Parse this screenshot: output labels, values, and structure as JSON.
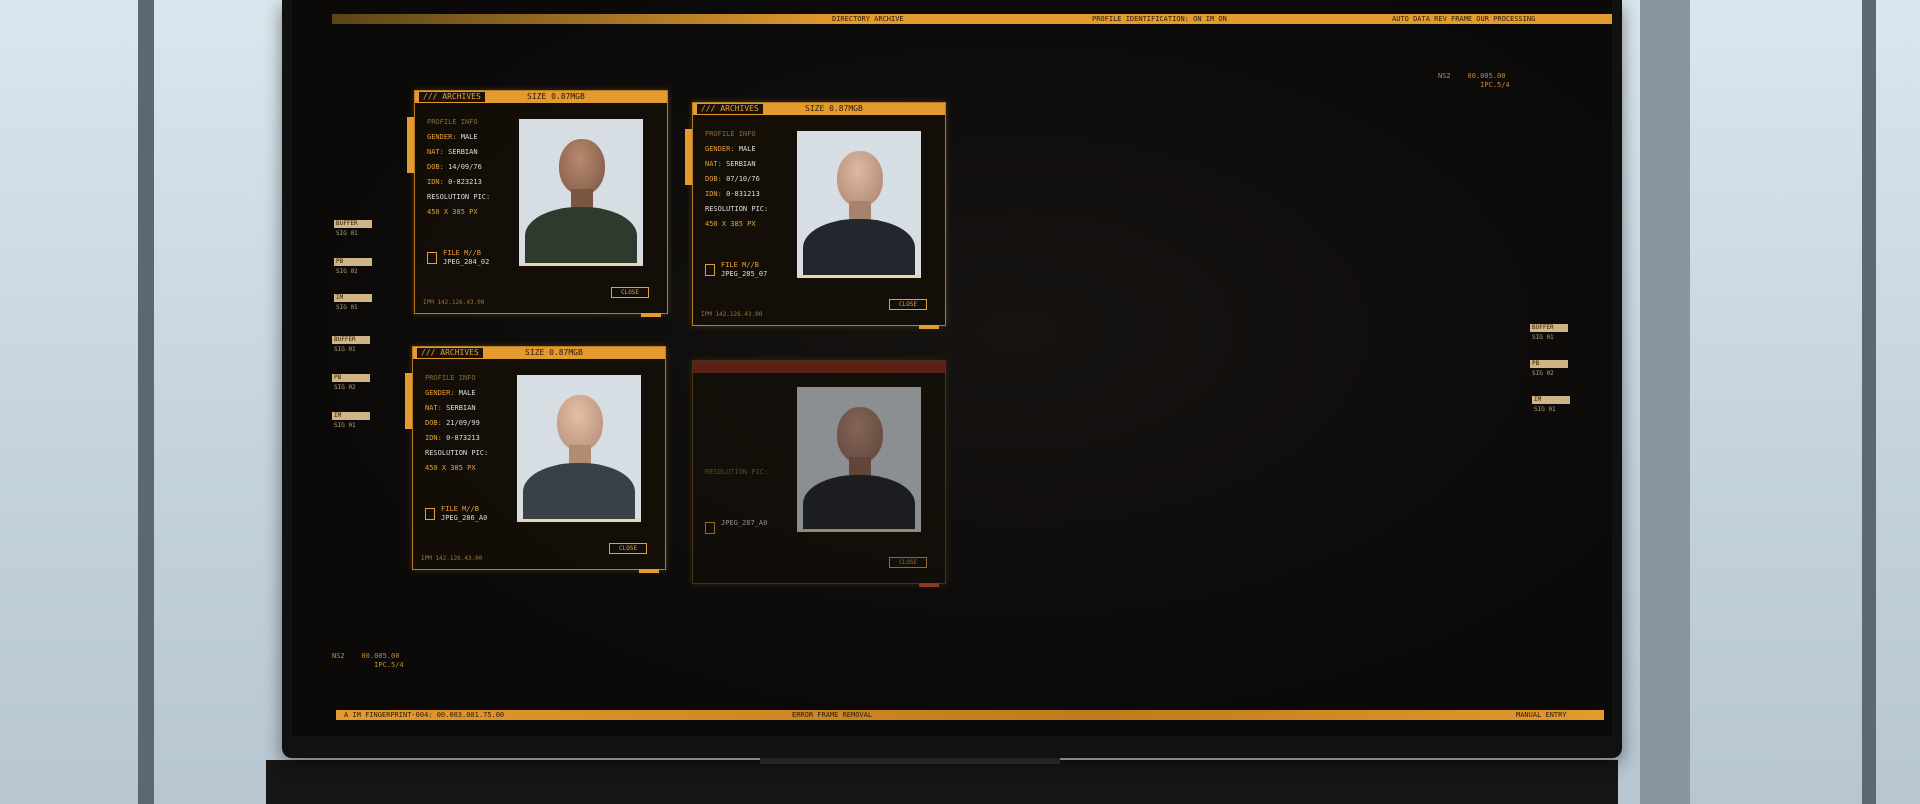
{
  "cards": [
    {
      "header": "/// ARCHIVES",
      "size": "SIZE 0.87MGB",
      "profile_info": "PROFILE INFO",
      "gender_label": "GENDER:",
      "gender": "MALE",
      "nat_label": "NAT:",
      "nat": "SERBIAN",
      "dob_label": "DOB:",
      "dob": "14/09/76",
      "idn_label": "IDN:",
      "idn": "0-823213",
      "res_label": "RESOLUTION PIC:",
      "res": "450 X 385 PX",
      "file_label": "FILE M//B",
      "file_name": "JPEG_284_02",
      "close": "CLOSE",
      "ipm": "IPM 142.126.43.00"
    },
    {
      "header": "/// ARCHIVES",
      "size": "SIZE 0.87MGB",
      "profile_info": "PROFILE INFO",
      "gender_label": "GENDER:",
      "gender": "MALE",
      "nat_label": "NAT:",
      "nat": "SERBIAN",
      "dob_label": "DOB:",
      "dob": "07/10/76",
      "idn_label": "IDN:",
      "idn": "0-831213",
      "res_label": "RESOLUTION PIC:",
      "res": "450 X 385 PX",
      "file_label": "FILE M//B",
      "file_name": "JPEG_285_07",
      "close": "CLOSE",
      "ipm": "IPM 142.126.43.00"
    },
    {
      "header": "/// ARCHIVES",
      "size": "SIZE 0.87MGB",
      "profile_info": "PROFILE INFO",
      "gender_label": "GENDER:",
      "gender": "MALE",
      "nat_label": "NAT:",
      "nat": "SERBIAN",
      "dob_label": "DOB:",
      "dob": "21/09/99",
      "idn_label": "IDN:",
      "idn": "0-873213",
      "res_label": "RESOLUTION PIC:",
      "res": "450 X 385 PX",
      "file_label": "FILE M//B",
      "file_name": "JPEG_286_A0",
      "close": "CLOSE",
      "ipm": "IPM 142.126.43.00"
    },
    {
      "res_label": "RESOLUTION PIC:",
      "file_name": "JPEG_287_A0",
      "close": "CLOSE"
    }
  ],
  "left_tags": [
    {
      "label": "BUFFER",
      "sub": "SIG 01"
    },
    {
      "label": "PB",
      "sub": "SIG 02"
    },
    {
      "label": "IM",
      "sub": "SIG 01"
    },
    {
      "label": "BUFFER",
      "sub": "SIG 01"
    },
    {
      "label": "PB",
      "sub": "SIG 02"
    },
    {
      "label": "IM",
      "sub": "SIG 01"
    }
  ],
  "right_tags": [
    {
      "label": "BUFFER",
      "sub": "SIG 01"
    },
    {
      "label": "PB",
      "sub": "SIG 02"
    },
    {
      "label": "IM",
      "sub": "SIG 01"
    }
  ],
  "top_bar": {
    "text_left": "DIRECTORY ARCHIVE",
    "text_mid": "PROFILE IDENTIFICATION: ON  IM ON",
    "text_right": "AUTO  DATA REV  FRAME  OUR PROCESSING"
  },
  "bottom_bar": {
    "text_left": "A IM FINGERPRINT-004: 00.003.001.75.00",
    "text_mid": "ERROR FRAME REMOVAL",
    "text_right": "MANUAL ENTRY"
  },
  "corner_tr": "NS2    00.005.00\n          IPC.5/4",
  "corner_bl": "NS2    00.005.00\n          IPC.5/4"
}
